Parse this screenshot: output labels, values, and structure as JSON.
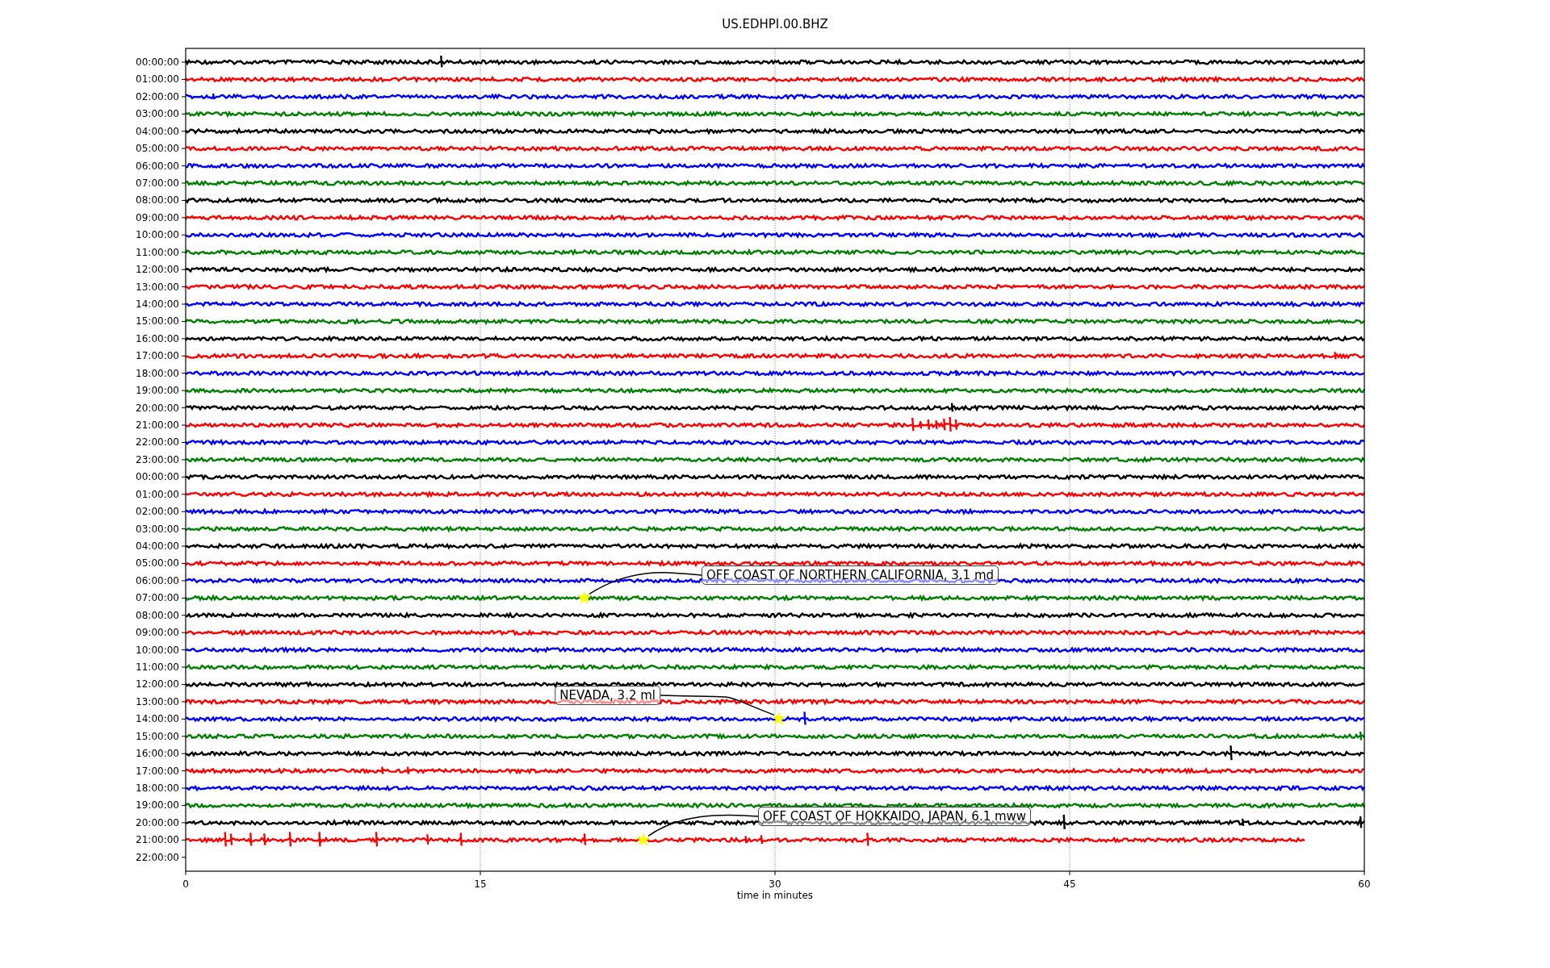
{
  "title": "US.EDHPI.00.BHZ",
  "x_axis": {
    "label": "time in minutes",
    "ticks": [
      "0",
      "15",
      "30",
      "45",
      "60"
    ]
  },
  "rows": [
    {
      "label": "00:00:00",
      "color": "#000000",
      "kind": "full"
    },
    {
      "label": "01:00:00",
      "color": "#ff0000",
      "kind": "full"
    },
    {
      "label": "02:00:00",
      "color": "#0000ff",
      "kind": "full"
    },
    {
      "label": "03:00:00",
      "color": "#008000",
      "kind": "full"
    },
    {
      "label": "04:00:00",
      "color": "#000000",
      "kind": "full"
    },
    {
      "label": "05:00:00",
      "color": "#ff0000",
      "kind": "full"
    },
    {
      "label": "06:00:00",
      "color": "#0000ff",
      "kind": "full"
    },
    {
      "label": "07:00:00",
      "color": "#008000",
      "kind": "full"
    },
    {
      "label": "08:00:00",
      "color": "#000000",
      "kind": "full"
    },
    {
      "label": "09:00:00",
      "color": "#ff0000",
      "kind": "full"
    },
    {
      "label": "10:00:00",
      "color": "#0000ff",
      "kind": "full"
    },
    {
      "label": "11:00:00",
      "color": "#008000",
      "kind": "full"
    },
    {
      "label": "12:00:00",
      "color": "#000000",
      "kind": "full"
    },
    {
      "label": "13:00:00",
      "color": "#ff0000",
      "kind": "full"
    },
    {
      "label": "14:00:00",
      "color": "#0000ff",
      "kind": "full"
    },
    {
      "label": "15:00:00",
      "color": "#008000",
      "kind": "full"
    },
    {
      "label": "16:00:00",
      "color": "#000000",
      "kind": "full"
    },
    {
      "label": "17:00:00",
      "color": "#ff0000",
      "kind": "full"
    },
    {
      "label": "18:00:00",
      "color": "#0000ff",
      "kind": "full"
    },
    {
      "label": "19:00:00",
      "color": "#008000",
      "kind": "full"
    },
    {
      "label": "20:00:00",
      "color": "#000000",
      "kind": "full"
    },
    {
      "label": "21:00:00",
      "color": "#ff0000",
      "kind": "full"
    },
    {
      "label": "22:00:00",
      "color": "#0000ff",
      "kind": "full"
    },
    {
      "label": "23:00:00",
      "color": "#008000",
      "kind": "full"
    },
    {
      "label": "00:00:00",
      "color": "#000000",
      "kind": "full"
    },
    {
      "label": "01:00:00",
      "color": "#ff0000",
      "kind": "full"
    },
    {
      "label": "02:00:00",
      "color": "#0000ff",
      "kind": "full"
    },
    {
      "label": "03:00:00",
      "color": "#008000",
      "kind": "full"
    },
    {
      "label": "04:00:00",
      "color": "#000000",
      "kind": "full"
    },
    {
      "label": "05:00:00",
      "color": "#ff0000",
      "kind": "full"
    },
    {
      "label": "06:00:00",
      "color": "#0000ff",
      "kind": "full"
    },
    {
      "label": "07:00:00",
      "color": "#008000",
      "kind": "full",
      "event": {
        "text": "OFF COAST OF NORTHERN CALIFORNIA, 3.1 md"
      }
    },
    {
      "label": "08:00:00",
      "color": "#000000",
      "kind": "full"
    },
    {
      "label": "09:00:00",
      "color": "#ff0000",
      "kind": "full"
    },
    {
      "label": "10:00:00",
      "color": "#0000ff",
      "kind": "full"
    },
    {
      "label": "11:00:00",
      "color": "#008000",
      "kind": "full"
    },
    {
      "label": "12:00:00",
      "color": "#000000",
      "kind": "full"
    },
    {
      "label": "13:00:00",
      "color": "#ff0000",
      "kind": "full"
    },
    {
      "label": "14:00:00",
      "color": "#0000ff",
      "kind": "full",
      "event": {
        "text": "NEVADA, 3.2 ml"
      }
    },
    {
      "label": "15:00:00",
      "color": "#008000",
      "kind": "full"
    },
    {
      "label": "16:00:00",
      "color": "#000000",
      "kind": "full"
    },
    {
      "label": "17:00:00",
      "color": "#ff0000",
      "kind": "full"
    },
    {
      "label": "18:00:00",
      "color": "#0000ff",
      "kind": "full"
    },
    {
      "label": "19:00:00",
      "color": "#008000",
      "kind": "full"
    },
    {
      "label": "20:00:00",
      "color": "#000000",
      "kind": "full"
    },
    {
      "label": "21:00:00",
      "color": "#ff0000",
      "kind": "partial",
      "event": {
        "text": "OFF COAST OF HOKKAIDO, JAPAN, 6.1 mww"
      }
    },
    {
      "label": "22:00:00",
      "kind": "empty"
    }
  ]
}
